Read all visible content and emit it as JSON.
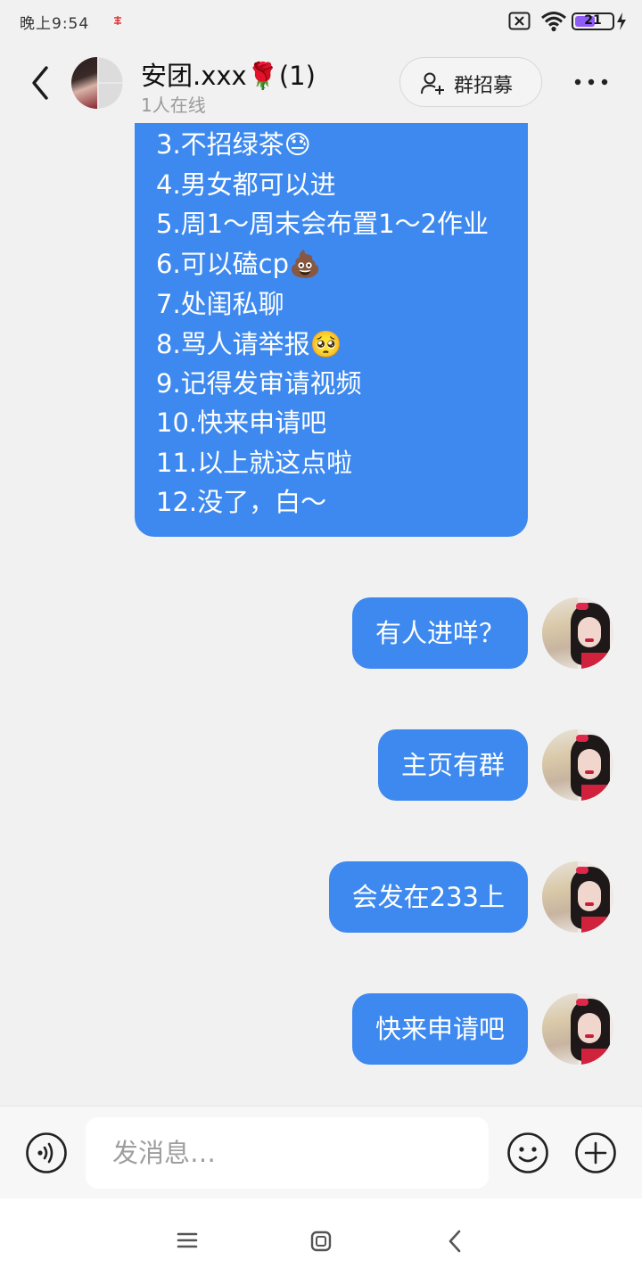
{
  "status_bar": {
    "time": "晚上9:54",
    "battery": "21",
    "battery_percent": 21,
    "battery_color": "#8f5cf5"
  },
  "header": {
    "group_name": "安团.xxx🌹(1)",
    "online_status": "1人在线",
    "recruit_label": "群招募"
  },
  "announcement": {
    "lines": [
      "3.不招绿茶😓",
      "4.男女都可以进",
      "5.周1～周末会布置1～2作业",
      "6.可以磕cp💩",
      "7.处闺私聊",
      "8.骂人请举报🥺",
      "9.记得发审请视频",
      "10.快来申请吧",
      "11.以上就这点啦",
      "12.没了，白～"
    ]
  },
  "messages": [
    {
      "text": "有人进咩？"
    },
    {
      "text": "主页有群"
    },
    {
      "text": "会发在233上"
    },
    {
      "text": "快来申请吧"
    }
  ],
  "input": {
    "placeholder": "发消息…"
  },
  "colors": {
    "bubble": "#3d89ef",
    "background": "#f1f1f2"
  },
  "icons": {
    "back": "chevron-left-icon",
    "recruit": "add-person-icon",
    "more": "more-dots-icon",
    "voice": "voice-icon",
    "emoji": "smiley-icon",
    "plus": "plus-circle-icon",
    "nav_menu": "menu-icon",
    "nav_home": "home-square-icon",
    "nav_back": "nav-back-icon"
  }
}
